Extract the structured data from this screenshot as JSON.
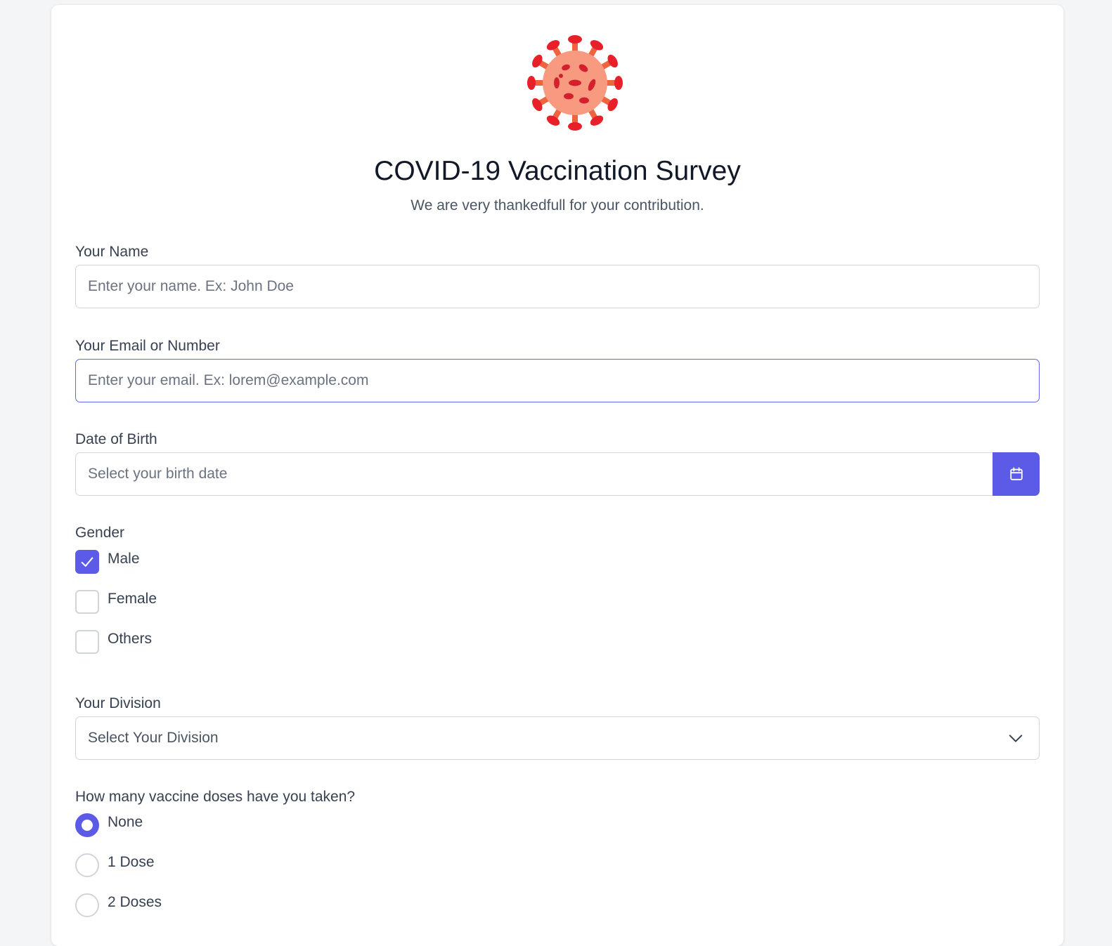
{
  "header": {
    "title": "COVID-19 Vaccination Survey",
    "subtitle": "We are very thankedfull for your contribution.",
    "logo_icon": "virus-icon"
  },
  "form": {
    "name": {
      "label": "Your Name",
      "placeholder": "Enter your name. Ex: John Doe",
      "value": ""
    },
    "contact": {
      "label": "Your Email or Number",
      "placeholder": "Enter your email. Ex: lorem@example.com",
      "value": "",
      "focused": true
    },
    "dob": {
      "label": "Date of Birth",
      "placeholder": "Select your birth date",
      "value": "",
      "button_icon": "calendar-icon"
    },
    "gender": {
      "label": "Gender",
      "options": [
        {
          "label": "Male",
          "checked": true
        },
        {
          "label": "Female",
          "checked": false
        },
        {
          "label": "Others",
          "checked": false
        }
      ]
    },
    "division": {
      "label": "Your Division",
      "selected": "Select Your Division",
      "icon": "chevron-down-icon"
    },
    "doses": {
      "label": "How many vaccine doses have you taken?",
      "options": [
        {
          "label": "None",
          "checked": true
        },
        {
          "label": "1 Dose",
          "checked": false
        },
        {
          "label": "2 Doses",
          "checked": false
        }
      ]
    }
  },
  "colors": {
    "accent": "#5b5be8",
    "virus_body": "#f79a80",
    "virus_spike": "#f0633f",
    "virus_dots": "#d4202c",
    "text_dark": "#111827",
    "text_muted": "#4b5563"
  }
}
